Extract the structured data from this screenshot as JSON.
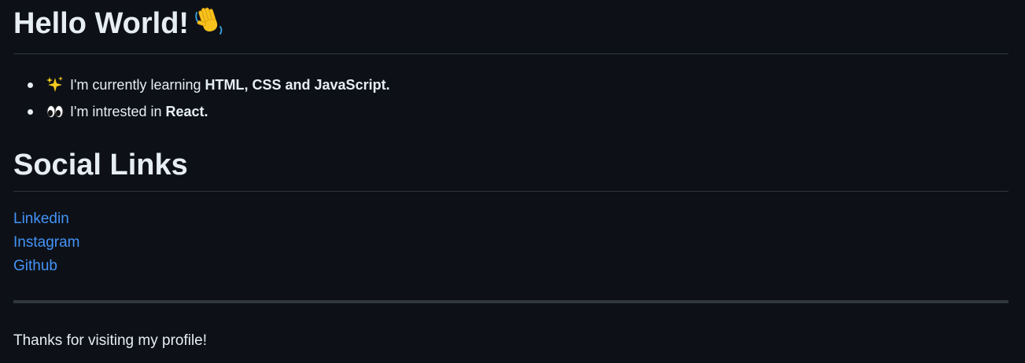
{
  "header": {
    "title": "Hello World!",
    "title_icon": "waving-hand-icon"
  },
  "bullets": [
    {
      "icon": "sparkles-icon",
      "text": "I'm currently learning ",
      "strong": "HTML, CSS and JavaScript."
    },
    {
      "icon": "eyes-icon",
      "text": "I'm intrested in ",
      "strong": "React."
    }
  ],
  "social": {
    "heading": "Social Links",
    "links": [
      {
        "label": "Linkedin"
      },
      {
        "label": "Instagram"
      },
      {
        "label": "Github"
      }
    ]
  },
  "footer": {
    "text": "Thanks for visiting my profile!"
  },
  "colors": {
    "background": "#0d1117",
    "text": "#e6edf3",
    "link": "#4493f8",
    "divider": "#30363d"
  }
}
